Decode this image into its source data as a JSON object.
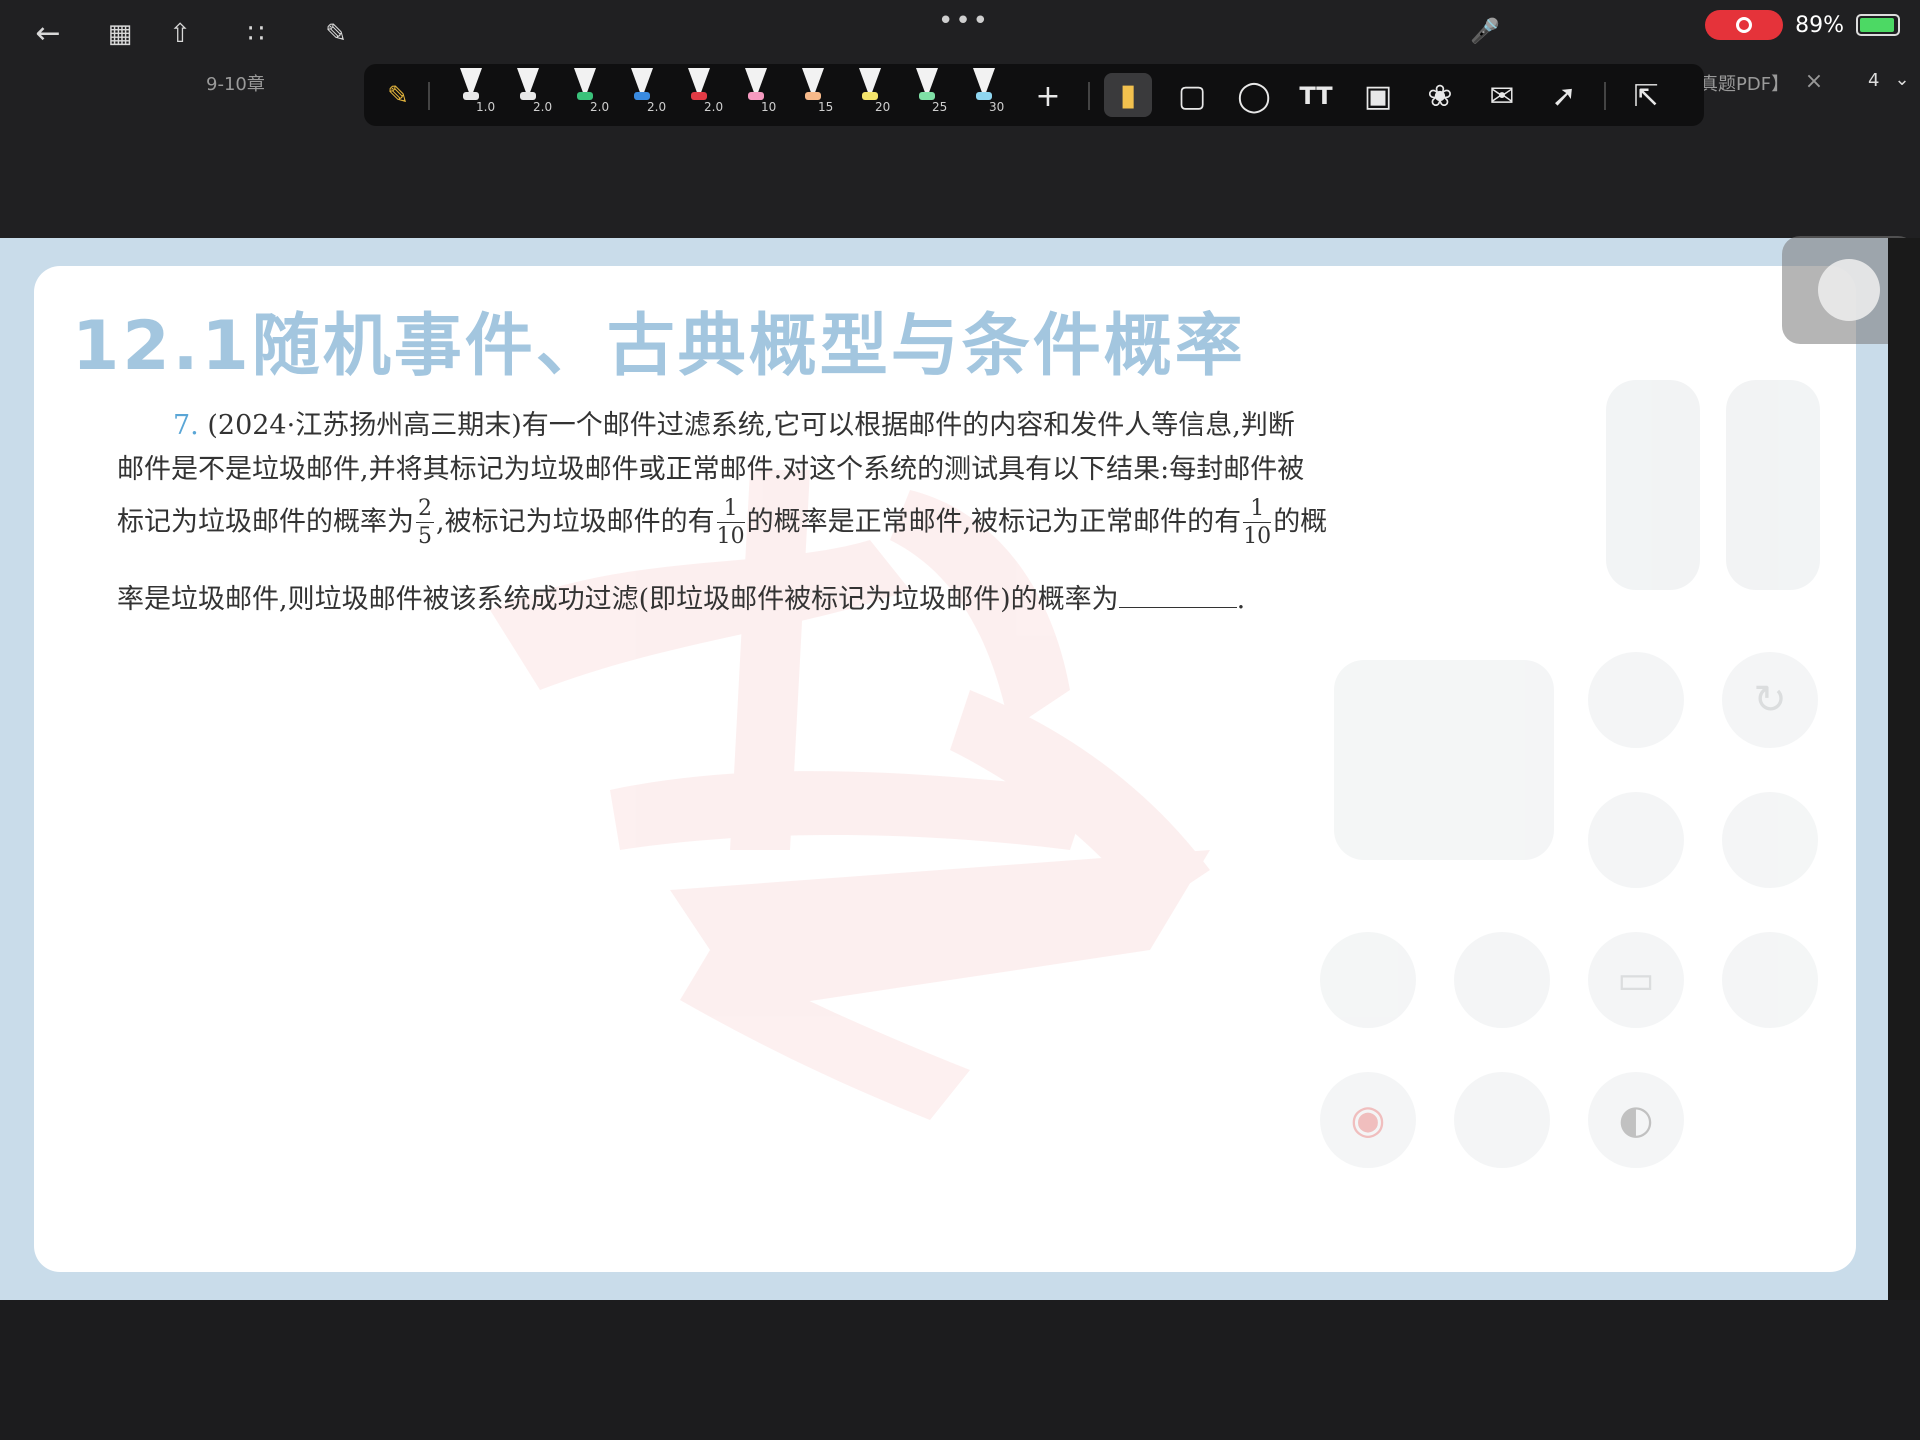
{
  "topbar": {
    "tab_left": "9-10章",
    "tab_right": "真题PDF】",
    "page_indicator": "4",
    "battery": "89%",
    "more_dots": "•••"
  },
  "pen_tool": {
    "pens": [
      {
        "size": "1.0",
        "cap": "#e8e8e8"
      },
      {
        "size": "2.0",
        "cap": "#e8e8e8"
      },
      {
        "size": "2.0",
        "cap": "#3ac17a"
      },
      {
        "size": "2.0",
        "cap": "#3a8be0"
      },
      {
        "size": "2.0",
        "cap": "#e23b45"
      },
      {
        "size": "10",
        "cap": "#f59ac0"
      },
      {
        "size": "15",
        "cap": "#f7b98a"
      },
      {
        "size": "20",
        "cap": "#f2e36b"
      },
      {
        "size": "25",
        "cap": "#7fe0a6"
      },
      {
        "size": "30",
        "cap": "#8fd6f0"
      }
    ],
    "add": "+",
    "text_tool": "TT"
  },
  "document": {
    "heading": "12.1随机事件、古典概型与条件概率",
    "problem_number": "7.",
    "line1": "(2024·江苏扬州高三期末)有一个邮件过滤系统,它可以根据邮件的内容和发件人等信息,判断",
    "line2": "邮件是不是垃圾邮件,并将其标记为垃圾邮件或正常邮件.对这个系统的测试具有以下结果:每封邮件被",
    "line3_a": "标记为垃圾邮件的概率为",
    "frac1_n": "2",
    "frac1_d": "5",
    "line3_b": ",被标记为垃圾邮件的有",
    "frac2_n": "1",
    "frac2_d": "10",
    "line3_c": "的概率是正常邮件,被标记为正常邮件的有",
    "frac3_n": "1",
    "frac3_d": "10",
    "line3_d": "的概",
    "line4": "率是垃圾邮件,则垃圾邮件被该系统成功过滤(即垃圾邮件被标记为垃圾邮件)的概率为",
    "line4_end": "."
  },
  "colors": {
    "accent_blue": "#5aa6d6",
    "heading": "#a3c6df",
    "watermark": "#e03030"
  }
}
